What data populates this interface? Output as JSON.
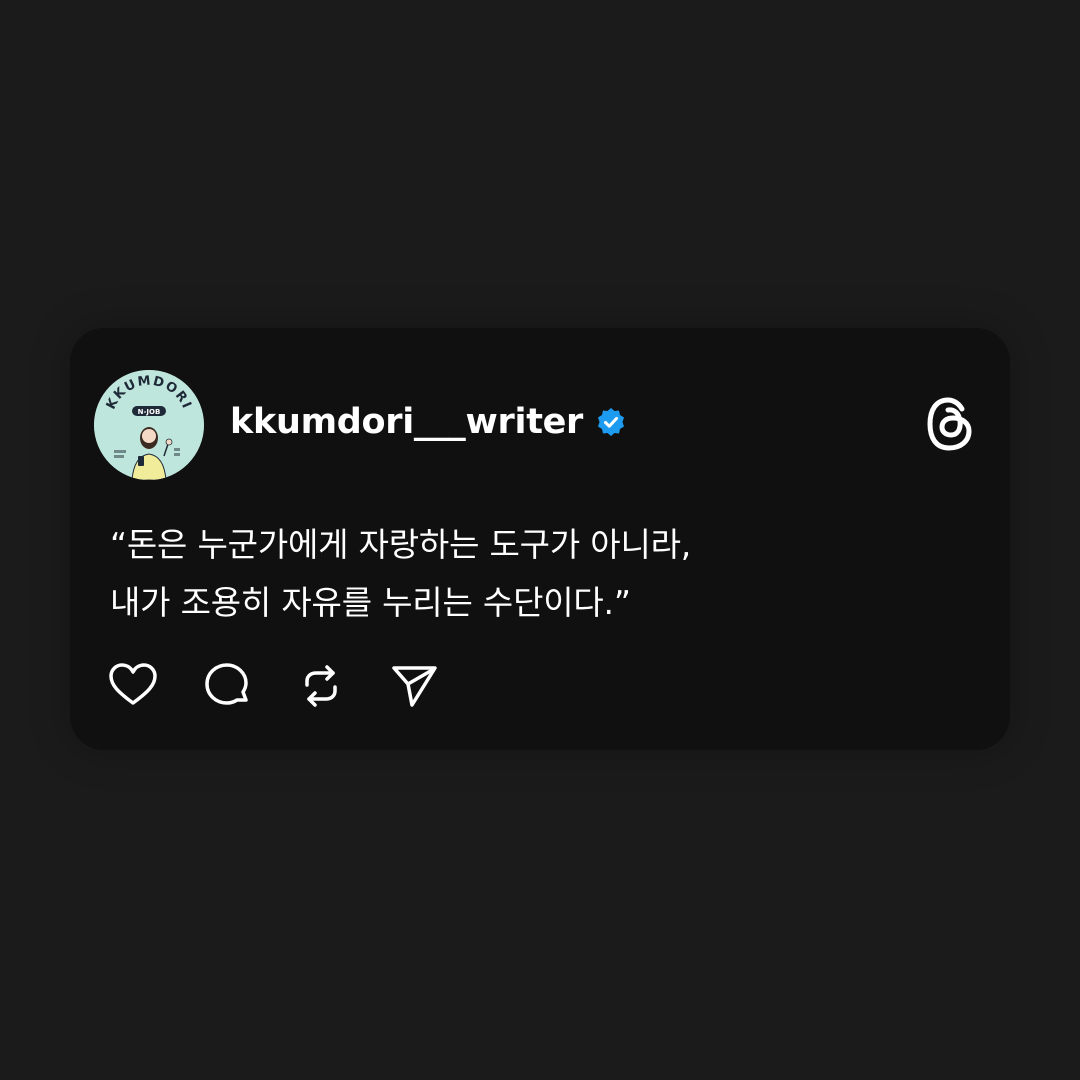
{
  "post": {
    "author": {
      "username": "kkumdori___writer",
      "verified": true,
      "avatar_badge_text": "KKUMDORI",
      "avatar_badge_subtext": "N-JOB"
    },
    "text_lines": [
      "“돈은 누군가에게 자랑하는 도구가 아니라,",
      "내가 조용히 자유를 누리는 수단이다.”"
    ],
    "actions": [
      {
        "name": "like",
        "icon": "heart-icon"
      },
      {
        "name": "reply",
        "icon": "comment-icon"
      },
      {
        "name": "repost",
        "icon": "repost-icon"
      },
      {
        "name": "share",
        "icon": "send-icon"
      }
    ]
  },
  "brand": {
    "logo": "threads-logo-icon"
  },
  "colors": {
    "background": "#1b1b1b",
    "card": "#101010",
    "text": "#ffffff",
    "verified": "#1d9bf0",
    "avatar_bg": "#bfe6dd"
  }
}
